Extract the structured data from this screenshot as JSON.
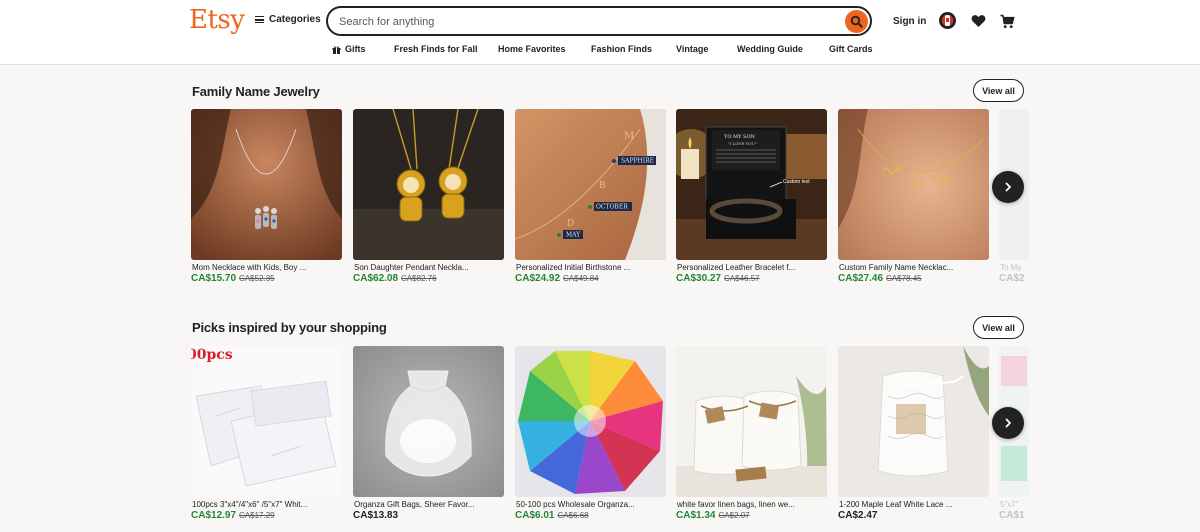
{
  "header": {
    "logo": "Etsy",
    "categories_label": "Categories",
    "search_placeholder": "Search for anything",
    "signin_label": "Sign in"
  },
  "nav": [
    {
      "label": "Gifts"
    },
    {
      "label": "Fresh Finds for Fall"
    },
    {
      "label": "Home Favorites"
    },
    {
      "label": "Fashion Finds"
    },
    {
      "label": "Vintage"
    },
    {
      "label": "Wedding Guide"
    },
    {
      "label": "Gift Cards"
    }
  ],
  "colors": {
    "brand": "#f1641e",
    "sale_price": "#258635",
    "text": "#222222",
    "background": "#f8f7f5"
  },
  "family_section": {
    "title": "Family Name Jewelry",
    "view_all": "View all",
    "items": [
      {
        "title": "Mom Necklace with Kids, Boy ...",
        "price": "CA$15.70",
        "old_price": "CA$52.35"
      },
      {
        "title": "Son Daughter Pendant Neckla...",
        "price": "CA$62.08",
        "old_price": "CA$82.76"
      },
      {
        "title": "Personalized Initial Birthstone ...",
        "price": "CA$24.92",
        "old_price": "CA$49.84",
        "image_text": {
          "l1": "M",
          "l2": "SAPPHIRE",
          "l3": "B",
          "l4": "OCTOBER",
          "l5": "D",
          "l6": "MAY"
        }
      },
      {
        "title": "Personalized Leather Bracelet f...",
        "price": "CA$30.27",
        "old_price": "CA$46.57",
        "image_text": {
          "box_title": "TO MY SON",
          "box_sub": "\"I LOVE YOU\"",
          "callout": "Custom text"
        }
      },
      {
        "title": "Custom Family Name Necklac...",
        "price": "CA$27.46",
        "old_price": "CA$78.45"
      },
      {
        "title": "To My",
        "price": "CA$2",
        "old_price": ""
      }
    ]
  },
  "picks_section": {
    "title": "Picks inspired by your shopping",
    "view_all": "View all",
    "items": [
      {
        "title": "100pcs 3\"x4\"/4\"x6\" /5\"x7\" Whit...",
        "price": "CA$12.97",
        "old_price": "CA$17.29",
        "image_text": "00pcs"
      },
      {
        "title": "Organza Gift Bags, Sheer Favor...",
        "price": "CA$13.83",
        "old_price": ""
      },
      {
        "title": "50-100 pcs Wholesale Organza...",
        "price": "CA$6.01",
        "old_price": "CA$6.68"
      },
      {
        "title": "white favor linen bags, linen we...",
        "price": "CA$1.34",
        "old_price": "CA$2.07"
      },
      {
        "title": "1-200 Maple Leaf White Lace ...",
        "price": "CA$2.47",
        "old_price": ""
      },
      {
        "title": "5\"x7\"",
        "price": "CA$1",
        "old_price": ""
      }
    ]
  }
}
